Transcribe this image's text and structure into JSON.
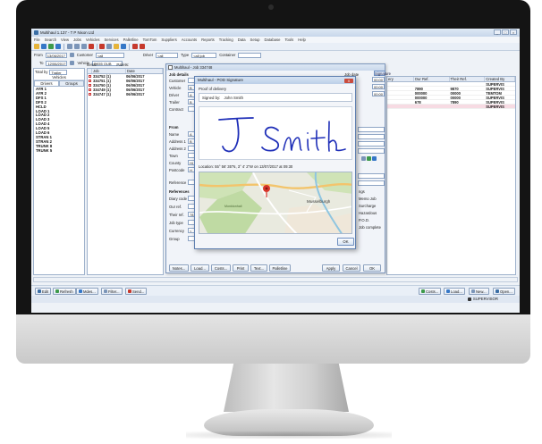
{
  "app": {
    "title": "Multihaul 1.137 - T P Nixon Ltd",
    "menu": [
      "File",
      "Search",
      "View",
      "Jobs",
      "Vehicles",
      "Services",
      "Palletline",
      "TomTom",
      "Suppliers",
      "Accounts",
      "Reports",
      "Tracking",
      "Data",
      "Setup",
      "Database",
      "Tools",
      "Help"
    ]
  },
  "filters": {
    "from_label": "From",
    "from_value": "13/06/2017",
    "to_label": "To",
    "to_value": "12/06/2017",
    "customer_label": "Customer",
    "customer_value": "<all customers>",
    "driver_label": "Driver",
    "driver_value": "<all drivers>",
    "type_label": "Type",
    "type_value": "<all job types>",
    "container_label": "Container",
    "vehicle_label": "Vehicle",
    "vehicle_value": "BK55 OUB",
    "total_label": "Total by",
    "total_value": "Trailer",
    "items_label": "Items:",
    "pallets_label": "Pallets:"
  },
  "left_panel": {
    "header": "Vehicles",
    "tabs": [
      "Drivers",
      "Groups"
    ],
    "items": [
      "AYR 1",
      "AYR 2",
      "DFS 1",
      "DFS 2",
      "HCLD",
      "LOAD 1",
      "LOAD 2",
      "LOAD 3",
      "LOAD 4",
      "LOAD 5",
      "LOAD 6",
      "STRAN 1",
      "STRAN 2",
      "TRUNK 8",
      "TRUNK 5"
    ]
  },
  "job_grid": {
    "columns": [
      "Job",
      "Date"
    ],
    "rows": [
      {
        "job": "334752 (1)",
        "date": "06/06/2017"
      },
      {
        "job": "334751 (1)",
        "date": "06/06/2017"
      },
      {
        "job": "334750 (1)",
        "date": "06/06/2017"
      },
      {
        "job": "334749 (1)",
        "date": "06/06/2017"
      },
      {
        "job": "334747 (1)",
        "date": "06/06/2017"
      }
    ]
  },
  "right_grid": {
    "columns": [
      "ery",
      "Our Ref.",
      "Their Ref.",
      "Created By"
    ],
    "rows": [
      {
        "pre": "",
        "our": "",
        "their": "",
        "created": "SUPERVIS",
        "pink": false
      },
      {
        "pre": "",
        "our": "7890",
        "their": "9870",
        "created": "SUPERVIS",
        "pink": false
      },
      {
        "pre": "",
        "our": "000000",
        "their": "00000",
        "created": "TEMTOM",
        "pink": false
      },
      {
        "pre": "",
        "our": "000000",
        "their": "00000",
        "created": "SUPERVIS",
        "pink": false
      },
      {
        "pre": "",
        "our": "678",
        "their": "7890",
        "created": "SUPERVIS",
        "pink": false
      },
      {
        "pre": "",
        "our": "",
        "their": "",
        "created": "SUPERVIS",
        "pink": true
      }
    ]
  },
  "job_window": {
    "title": "Multihaul - Job 334748",
    "details_section": "Job details",
    "job_date_label": "Job date",
    "detail_labels": [
      "Customer",
      "Vehicle",
      "Driver",
      "Trailer",
      "Contract"
    ],
    "detail_values": [
      "",
      "B",
      "A",
      "B",
      ""
    ],
    "signature_button": "Signature",
    "times": [
      "00:00",
      "00:00",
      "00:00"
    ],
    "from_section": "From",
    "from_labels": [
      "Name",
      "Address 1",
      "Address 2",
      "Town",
      "County",
      "Postcode",
      "Reference"
    ],
    "from_values": [
      "A",
      "B",
      "",
      "",
      "Hi",
      "H",
      ""
    ],
    "references_section": "References",
    "ref_labels": [
      "Diary code",
      "Our ref.",
      "Their ref.",
      "Job type",
      "Currency",
      "Group"
    ],
    "ref_values": [
      "",
      "",
      "78",
      "",
      "<",
      ""
    ],
    "right_labels": [
      "ngs",
      "Memo Job",
      "Surcharge",
      "Hazardous",
      "P.O.D.",
      "Job complete"
    ],
    "bottom_buttons": [
      "Notes...",
      "Load...",
      "Costs...",
      "Print",
      "Text...",
      "Palletline",
      "Apply",
      "Cancel",
      "OK"
    ]
  },
  "pod_dialog": {
    "title": "Multihaul - POD Signature",
    "proof_label": "Proof of delivery",
    "signed_label": "Signed by:",
    "signed_value": "John Smith",
    "signature_text": "J Smith",
    "location": "Location: 55° 56' 35\"N, 3° 4' 2\"W on 13/07/2017 at 09:30",
    "map_place_1": "Musselburgh",
    "map_place_2": "Monktonhall",
    "ok_label": "OK",
    "close_label": "X"
  },
  "bottom_bar": {
    "left_buttons": [
      "Edit",
      "Refresh",
      "Mdes...",
      "Filter...",
      "Send..."
    ],
    "right_buttons": [
      "Costs...",
      "Load...",
      "New...",
      "Open..."
    ]
  },
  "status": {
    "user": "SUPERVISOR"
  }
}
